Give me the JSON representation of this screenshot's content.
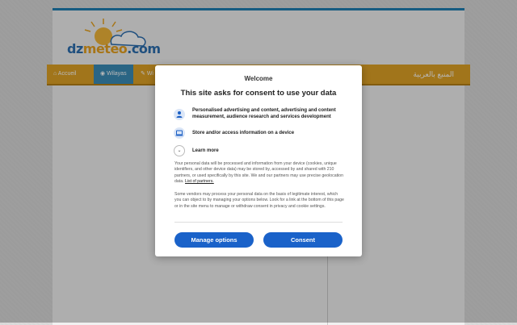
{
  "site": {
    "logo": {
      "part1": "dz",
      "part2": "meteo",
      "part3": ".com"
    },
    "nav": {
      "items": [
        {
          "label": "Accueil",
          "icon": "home-icon"
        },
        {
          "label": "Wilayas",
          "icon": "globe-icon"
        },
        {
          "label": "Wi",
          "icon": "pencil-icon"
        }
      ],
      "arabic_label": "المنبع بالعربية"
    }
  },
  "consent": {
    "welcome": "Welcome",
    "title": "This site asks for consent to use your data",
    "purposes": [
      {
        "icon": "person-icon",
        "text": "Personalised advertising and content, advertising and content measurement, audience research and services development"
      },
      {
        "icon": "device-icon",
        "text": "Store and/or access information on a device"
      }
    ],
    "learn_more": "Learn more",
    "paragraph1": "Your personal data will be processed and information from your device (cookies, unique identifiers, and other device data) may be stored by, accessed by and shared with 210 partners, or used specifically by this site. We and our partners may use precise geolocation data.",
    "partners_link": "List of partners.",
    "paragraph2": "Some vendors may process your personal data on the basis of legitimate interest, which you can object to by managing your options below. Look for a link at the bottom of this page or in the site menu to manage or withdraw consent in privacy and cookie settings.",
    "manage_button": "Manage options",
    "consent_button": "Consent",
    "colors": {
      "primary": "#1a62c9",
      "nav": "#e0a226",
      "nav_active": "#3b8db8"
    }
  }
}
